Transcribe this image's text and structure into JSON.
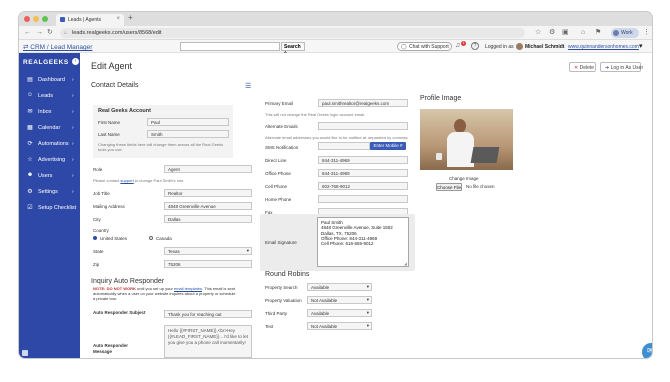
{
  "browser": {
    "tab_title": "Leads | Agents",
    "url": "leads.realgeeks.com/users/8568/edit",
    "work_profile": "Work"
  },
  "appbar": {
    "crm_link": "CRM / Lead Manager",
    "search_button": "Search",
    "chat_button": "Chat with Support",
    "notification_count": "1",
    "logged_in_as": "Logged in as",
    "user_name": "Michael Schmidt",
    "site_link": "www.quinnandersonhomes.com"
  },
  "sidebar": {
    "logo": "REALGEEKS",
    "items": [
      {
        "label": "Dashboard",
        "has_chevron": true
      },
      {
        "label": "Leads",
        "has_chevron": true
      },
      {
        "label": "Inbox",
        "has_chevron": true
      },
      {
        "label": "Calendar",
        "has_chevron": true
      },
      {
        "label": "Automations",
        "has_chevron": true
      },
      {
        "label": "Advertising",
        "has_chevron": true
      },
      {
        "label": "Users",
        "has_chevron": true
      },
      {
        "label": "Settings",
        "has_chevron": true
      },
      {
        "label": "Setup Checklist",
        "has_chevron": false
      }
    ]
  },
  "page": {
    "title": "Edit Agent",
    "delete_button": "Delete",
    "login_as_user_button": "Log in As User"
  },
  "contact_details": {
    "section_title": "Contact Details",
    "account_box": {
      "title": "Real Geeks Account",
      "first_name_label": "First Name",
      "first_name": "Paul",
      "last_name_label": "Last Name",
      "last_name": "Smith",
      "hint": "Changing these fields here will change them across all the Real Geeks tools you use."
    },
    "role_label": "Role",
    "role": "Agent",
    "password_hint_pre": "Please contact",
    "password_hint_link": "support",
    "password_hint_post": "to change Paul Smith's role.",
    "job_title_label": "Job Title",
    "job_title": "Realtor",
    "mailing_address_label": "Mailing Address",
    "mailing_address": "4848 Greenville Avenue",
    "city_label": "City",
    "city": "Dallas",
    "country_label": "Country",
    "country_options": [
      "United States",
      "Canada"
    ],
    "country_selected": "United States",
    "state_label": "State",
    "state": "Texas",
    "zip_label": "Zip",
    "zip": "75206"
  },
  "contact_right": {
    "primary_email_label": "Primary Email",
    "primary_email": "paul.smithrealtor@realgeeks.com",
    "primary_email_hint": "This will not change the Real Geeks login account email.",
    "alternate_emails_label": "Alternate Emails",
    "alternate_emails_hint": "Alternate email addresses you would like to be notified at, separated by commas.",
    "sms_label": "SMS Notification",
    "enter_mobile_button": "Enter Mobile #",
    "direct_line_label": "Direct Line",
    "direct_line": "844-311-4969",
    "office_phone_label": "Office Phone",
    "office_phone": "844-311-4969",
    "cell_phone_label": "Cell Phone",
    "cell_phone": "602-768-9012",
    "home_phone_label": "Home Phone",
    "fax_label": "Fax",
    "email_signature_label": "Email Signature",
    "email_signature_lines": [
      "Paul Smith",
      "4848 Greenville Avenue, Suite 1502",
      "Dallas, TX, 75206",
      "Office Phone: 844-311-4969",
      "Cell Phone: 616-555-9012"
    ]
  },
  "profile_image": {
    "title": "Profile Image",
    "change_label": "Change Image",
    "choose_button": "Choose File",
    "no_file": "No file chosen"
  },
  "inquiry": {
    "title": "Inquiry Auto Responder",
    "note_label": "NOTE:",
    "note_caps": "DO NOT WORK",
    "note_text_1": "until you set up your",
    "note_link": "email templates",
    "note_text_2": ". This email is sent automatically when a user on your website inquires about a property or schedule a private tour.",
    "subject_label": "Auto Responder Subject",
    "subject": "Thank you for reaching out",
    "message_label": "Auto Responder Message",
    "message": "Hello {{#FIRST_NAME}},<br>Hey {{#LEAD_FIRST_NAME}}... I'd like to let you give you a phone call momentarily!"
  },
  "round_robins": {
    "title": "Round Robins",
    "rows": [
      {
        "label": "Property Search",
        "value": "Available"
      },
      {
        "label": "Property Valuation",
        "value": "Not Available"
      },
      {
        "label": "Third Party",
        "value": "Available"
      },
      {
        "label": "Text",
        "value": "Not Available"
      }
    ]
  },
  "colors": {
    "sidebar": "#2e48a8",
    "primary_button": "#3a5cb7",
    "link": "#2d4fa0",
    "chat_bubble": "#3d8fd0"
  }
}
